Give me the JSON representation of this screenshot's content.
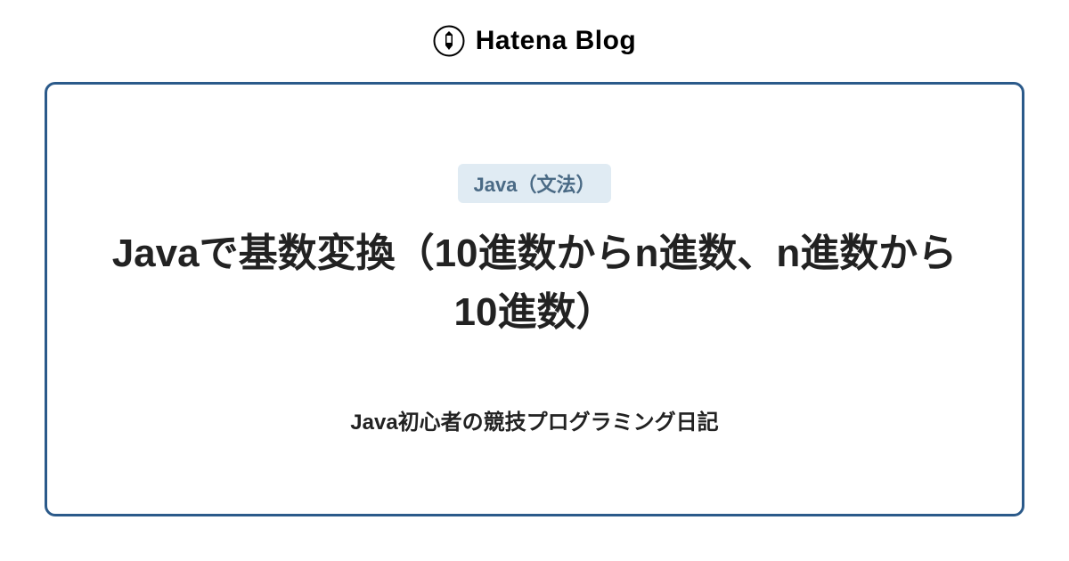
{
  "header": {
    "logo_text": "Hatena Blog"
  },
  "card": {
    "tag": "Java（文法）",
    "title": "Javaで基数変換（10進数からn進数、n進数から10進数）",
    "subtitle": "Java初心者の競技プログラミング日記"
  }
}
